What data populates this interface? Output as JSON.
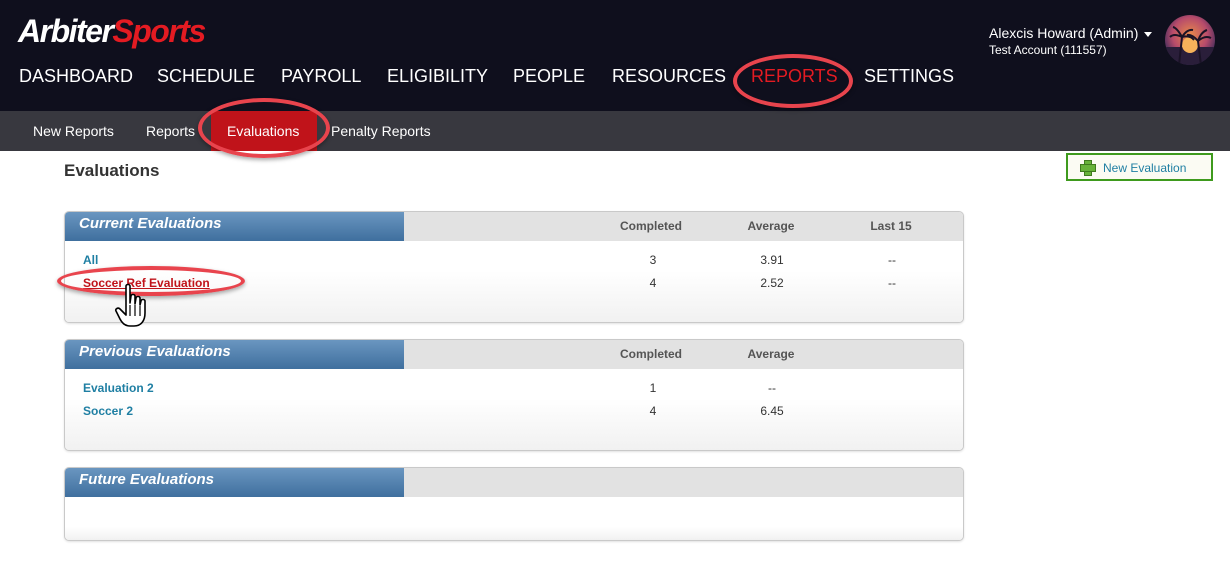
{
  "brand": {
    "part1": "Arbiter",
    "part2": "Sports"
  },
  "nav": {
    "items": [
      "DASHBOARD",
      "SCHEDULE",
      "PAYROLL",
      "ELIGIBILITY",
      "PEOPLE",
      "RESOURCES",
      "REPORTS",
      "SETTINGS"
    ],
    "active": "REPORTS"
  },
  "user": {
    "name": "Alexcis Howard (Admin)",
    "account": "Test Account (111557)"
  },
  "subnav": {
    "items": [
      "New Reports",
      "Reports",
      "Evaluations",
      "Penalty Reports"
    ],
    "active": "Evaluations"
  },
  "page": {
    "title": "Evaluations",
    "new_button": "New Evaluation"
  },
  "panels": [
    {
      "title": "Current Evaluations",
      "columns": [
        "Completed",
        "Average",
        "Last 15"
      ],
      "rows": [
        {
          "name": "All",
          "values": [
            "3",
            "3.91",
            "--"
          ]
        },
        {
          "name": "Soccer Ref Evaluation",
          "values": [
            "4",
            "2.52",
            "--"
          ]
        }
      ]
    },
    {
      "title": "Previous Evaluations",
      "columns": [
        "Completed",
        "Average"
      ],
      "rows": [
        {
          "name": "Evaluation 2",
          "values": [
            "1",
            "--"
          ]
        },
        {
          "name": "Soccer 2",
          "values": [
            "4",
            "6.45"
          ]
        }
      ]
    },
    {
      "title": "Future Evaluations",
      "columns": [],
      "rows": []
    }
  ],
  "colors": {
    "header_bg": "#0f0f1d",
    "accent_red": "#c0131a",
    "link_teal": "#1f7fa3",
    "panel_tab_blue": "#4f7fad",
    "highlight_ring": "#e8444d"
  },
  "icons": {
    "new_evaluation": "plus-icon",
    "user_menu": "caret-down-icon",
    "pointer": "hand-cursor-icon"
  }
}
